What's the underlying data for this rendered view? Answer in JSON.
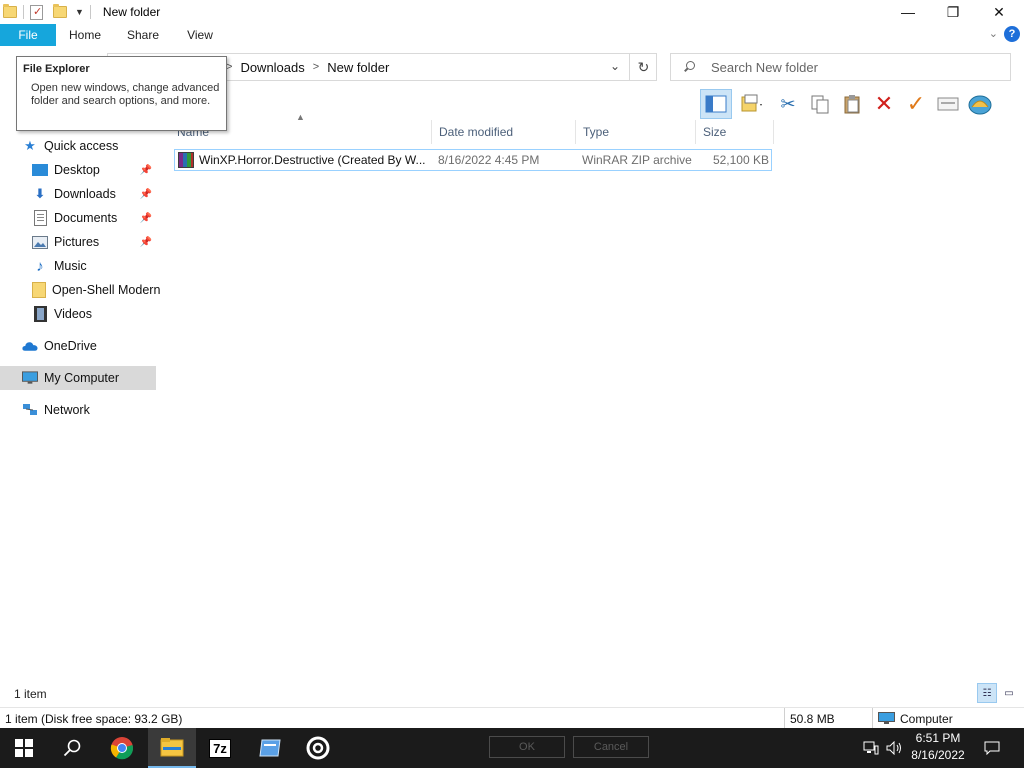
{
  "window": {
    "title": "New folder",
    "minimize_glyph": "—",
    "maximize_glyph": "❐",
    "close_glyph": "✕"
  },
  "ribbon": {
    "tabs": [
      {
        "label": "File",
        "active": true
      },
      {
        "label": "Home"
      },
      {
        "label": "Share"
      },
      {
        "label": "View"
      }
    ],
    "help_glyph": "?",
    "expand_glyph": "⌄"
  },
  "address": {
    "crumbs": [
      "Downloads",
      "New folder"
    ],
    "crumb_sep": ">"
  },
  "search": {
    "placeholder": "Search New folder"
  },
  "tooltip": {
    "title": "File Explorer",
    "body": "Open new windows, change advanced folder and search options, and more."
  },
  "nav": {
    "quick_access": "Quick access",
    "items": [
      {
        "label": "Desktop",
        "icon": "desktop-icon",
        "pinned": true
      },
      {
        "label": "Downloads",
        "icon": "download-arrow-icon",
        "pinned": true
      },
      {
        "label": "Documents",
        "icon": "document-icon",
        "pinned": true
      },
      {
        "label": "Pictures",
        "icon": "picture-icon",
        "pinned": true
      },
      {
        "label": "Music",
        "icon": "music-note-icon",
        "pinned": false
      },
      {
        "label": "Open-Shell Modern",
        "icon": "folder-icon",
        "pinned": false
      },
      {
        "label": "Videos",
        "icon": "film-icon",
        "pinned": false
      }
    ],
    "onedrive": "OneDrive",
    "my_computer": "My Computer",
    "network": "Network"
  },
  "columns": {
    "name": "Name",
    "date": "Date modified",
    "type": "Type",
    "size": "Size"
  },
  "files": [
    {
      "name": "WinXP.Horror.Destructive  (Created By W...",
      "date": "8/16/2022 4:45 PM",
      "type": "WinRAR ZIP archive",
      "size": "52,100 KB"
    }
  ],
  "status": {
    "item_count": "1 item",
    "detail": "1 item (Disk free space: 93.2 GB)",
    "size": "50.8 MB",
    "location": "Computer"
  },
  "taskbar": {
    "ok_label": "OK",
    "cancel_label": "Cancel",
    "time": "6:51 PM",
    "date": "8/16/2022",
    "seven_zip_label": "7z"
  },
  "colors": {
    "file_tab": "#16a6dc",
    "selection": "#99d1ff",
    "taskbar": "#1b1b1b"
  }
}
